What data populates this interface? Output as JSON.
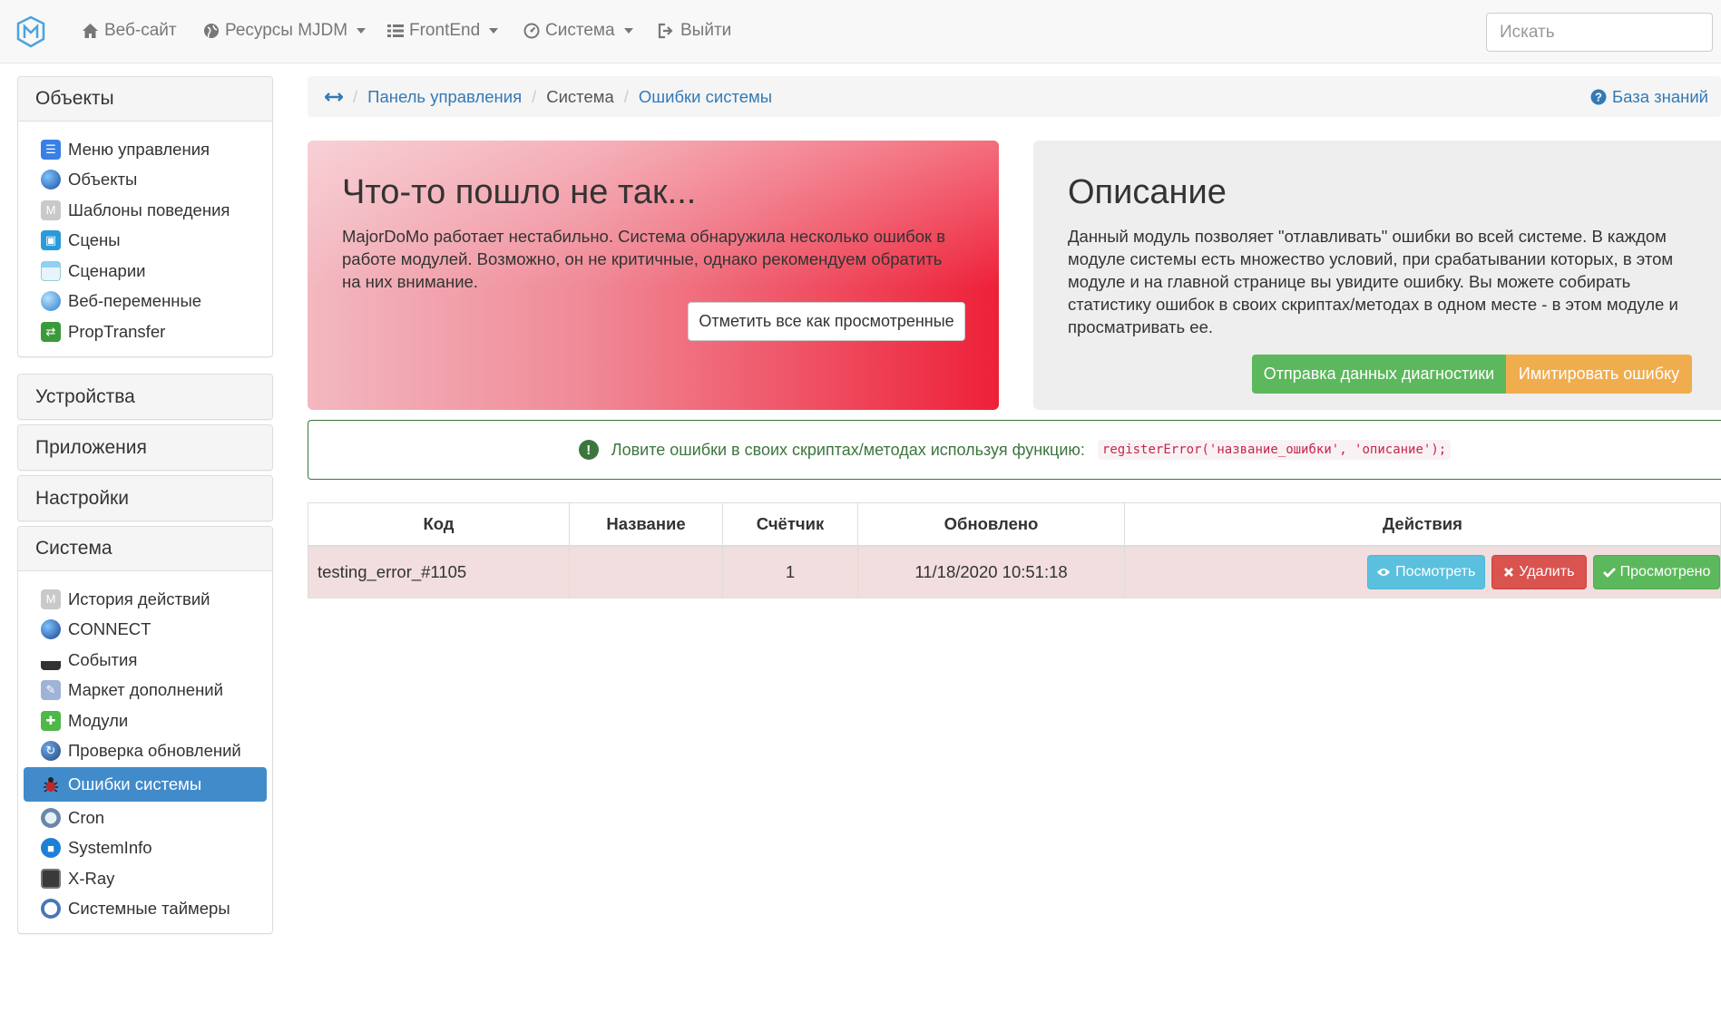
{
  "navbar": {
    "items": [
      {
        "label": "Веб-сайт",
        "icon": "home-icon"
      },
      {
        "label": "Ресурсы MJDM",
        "icon": "globe-icon"
      },
      {
        "label": "FrontEnd",
        "icon": "list-icon"
      },
      {
        "label": "Система",
        "icon": "dashboard-icon"
      },
      {
        "label": "Выйти",
        "icon": "logout-icon"
      }
    ],
    "search_placeholder": "Искать"
  },
  "sidebar": {
    "objects": {
      "title": "Объекты",
      "items": [
        "Меню управления",
        "Объекты",
        "Шаблоны поведения",
        "Сцены",
        "Сценарии",
        "Веб-переменные",
        "PropTransfer"
      ]
    },
    "devices": {
      "title": "Устройства"
    },
    "apps": {
      "title": "Приложения"
    },
    "settings": {
      "title": "Настройки"
    },
    "system": {
      "title": "Система",
      "items": [
        "История действий",
        "CONNECT",
        "События",
        "Маркет дополнений",
        "Модули",
        "Проверка обновлений",
        "Ошибки системы",
        "Cron",
        "SystemInfo",
        "X-Ray",
        "Системные таймеры"
      ],
      "active": "Ошибки системы"
    }
  },
  "breadcrumb": {
    "items": [
      "Панель управления",
      "Система",
      "Ошибки системы"
    ],
    "knowledge_base": "База знаний"
  },
  "error_box": {
    "title": "Что-то пошло не так...",
    "text": "MajorDoMo работает нестабильно. Система обнаружила несколько ошибок в работе модулей. Возможно, он не критичные, однако рекомендуем обратить на них внимание.",
    "button": "Отметить все как просмотренные"
  },
  "description_box": {
    "title": "Описание",
    "text": "Данный модуль позволяет \"отлавливать\" ошибки во всей системе. В каждом модуле системы есть множество условий, при срабатывании которых, в этом модуле и на главной странице вы увидите ошибку. Вы можете собирать статистику ошибок в своих скриптах/методах в одном месте - в этом модуле и просматривать ее.",
    "button_diagnostics": "Отправка данных диагностики",
    "button_simulate": "Имитировать ошибку"
  },
  "alert": {
    "text": "Ловите ошибки в своих скриптах/методах используя функцию:",
    "code": "registerError('название_ошибки', 'описание');"
  },
  "table": {
    "headers": {
      "code": "Код",
      "name": "Название",
      "counter": "Счётчик",
      "updated": "Обновлено",
      "actions": "Действия"
    },
    "rows": [
      {
        "code": "testing_error_#1105",
        "name": "",
        "counter": "1",
        "updated": "11/18/2020 10:51:18"
      }
    ],
    "actions": {
      "view": "Посмотреть",
      "delete": "Удалить",
      "seen": "Просмотрено"
    }
  },
  "colors": {
    "primary": "#428bca",
    "success": "#5cb85c",
    "warning": "#f0ad4e",
    "danger": "#d9534f",
    "info": "#5bc0de"
  }
}
